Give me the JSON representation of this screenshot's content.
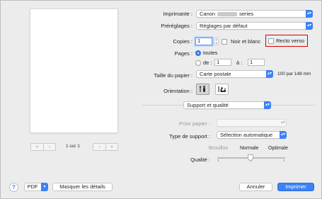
{
  "preview": {
    "page_info": "1 sur 1",
    "nav_first": "«",
    "nav_prev": "‹",
    "nav_next": "›",
    "nav_last": "»"
  },
  "printer": {
    "label": "Imprimante :",
    "brand": "Canon",
    "suffix": "series"
  },
  "presets": {
    "label": "Préréglages :",
    "value": "Réglages par défaut"
  },
  "copies": {
    "label": "Copies :",
    "value": "1",
    "bw_label": "Noir et blanc",
    "duplex_label": "Recto verso"
  },
  "pages": {
    "label": "Pages :",
    "all_label": "toutes",
    "from_label": "de :",
    "from_value": "1",
    "to_label": "à :",
    "to_value": "1"
  },
  "paper_size": {
    "label": "Taille du papier :",
    "value": "Carte postale",
    "dimensions": "100 par 148 mm"
  },
  "orientation": {
    "label": "Orientation :",
    "selected": "portrait"
  },
  "section": {
    "value": "Support et qualité"
  },
  "paper_source": {
    "label": "Prise papier :",
    "value": ""
  },
  "media_type": {
    "label": "Type de support :",
    "value": "Sélection automatique"
  },
  "quality": {
    "label": "Qualité :",
    "options": [
      "Brouillon",
      "Normale",
      "Optimale"
    ],
    "selected": "Normale"
  },
  "footer": {
    "help": "?",
    "pdf_label": "PDF",
    "details_label": "Masquer les détails",
    "cancel_label": "Annuler",
    "print_label": "Imprimer"
  },
  "colors": {
    "accent": "#3b82f6",
    "highlight": "#d40000"
  }
}
